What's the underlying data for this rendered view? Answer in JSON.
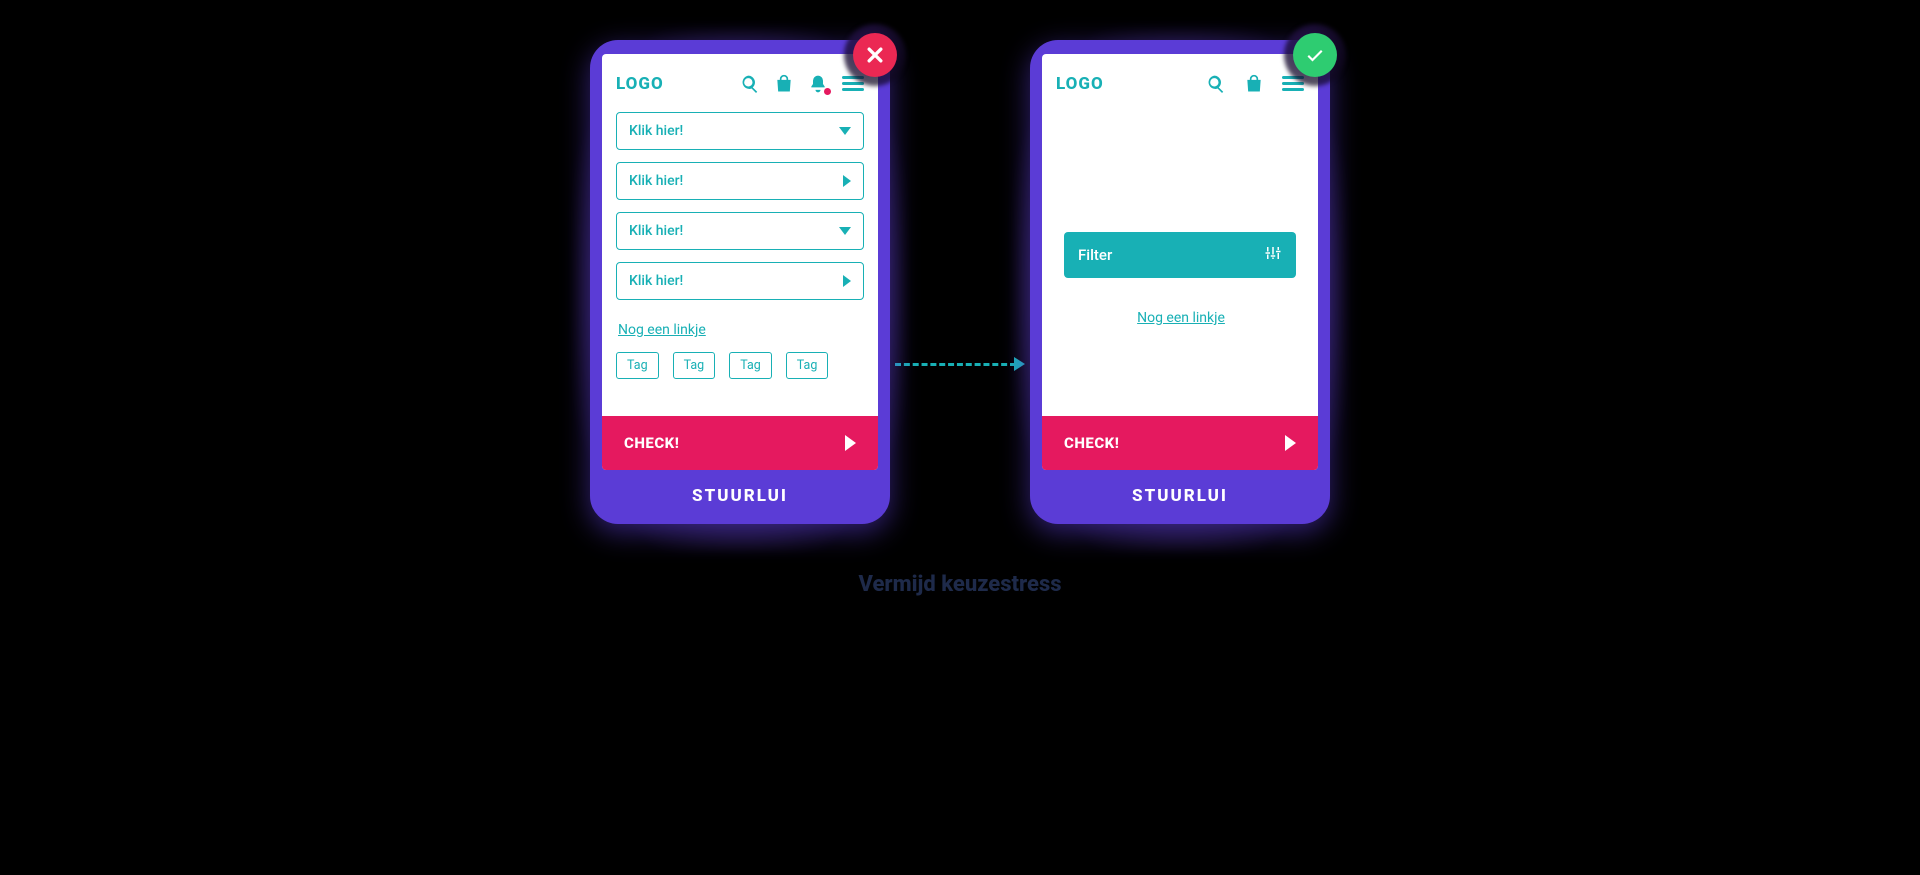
{
  "caption": "Vermijd keuzestress",
  "common": {
    "logo": "LOGO",
    "cta": "CHECK!",
    "brand": "STUURLUI",
    "link": "Nog een linkje"
  },
  "bad": {
    "selects": [
      "Klik hier!",
      "Klik hier!",
      "Klik hier!",
      "Klik hier!"
    ],
    "tags": [
      "Tag",
      "Tag",
      "Tag",
      "Tag"
    ]
  },
  "good": {
    "filter": "Filter"
  }
}
